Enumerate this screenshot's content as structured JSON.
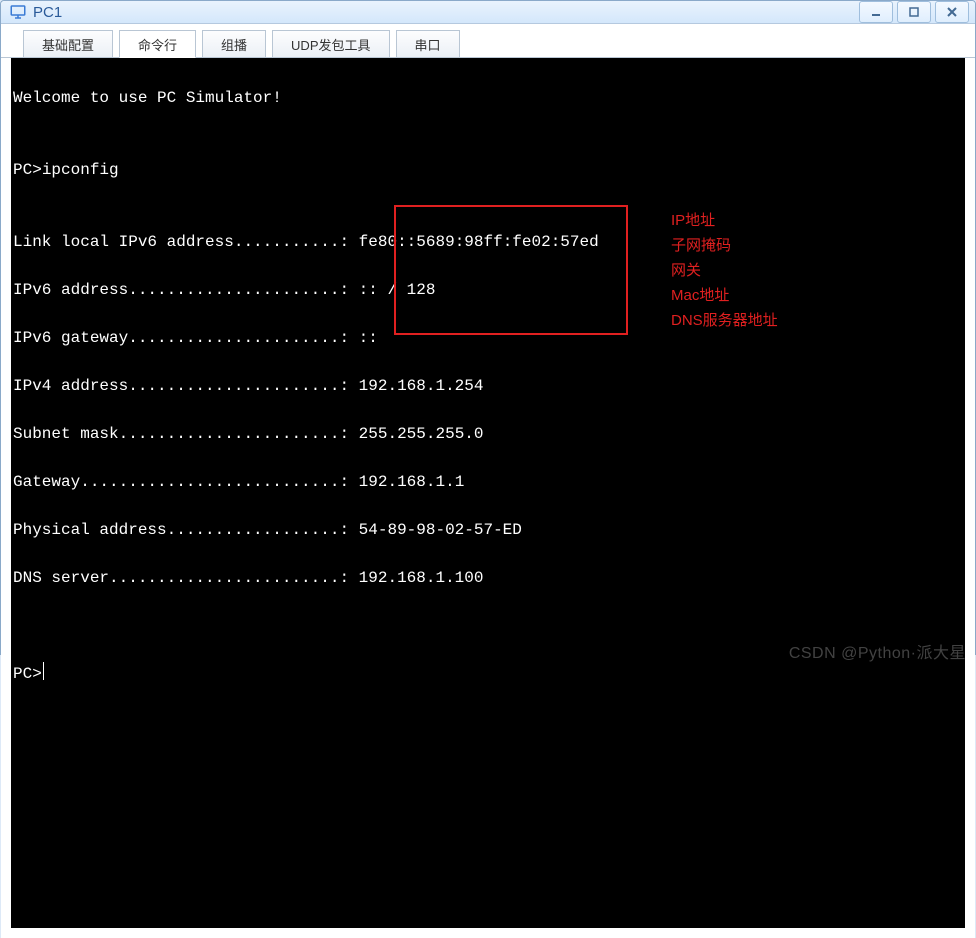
{
  "window": {
    "title": "PC1"
  },
  "tabs": [
    {
      "label": "基础配置"
    },
    {
      "label": "命令行"
    },
    {
      "label": "组播"
    },
    {
      "label": "UDP发包工具"
    },
    {
      "label": "串口"
    }
  ],
  "active_tab_index": 1,
  "terminal": {
    "welcome": "Welcome to use PC Simulator!",
    "prompt1": "PC>",
    "cmd1": "ipconfig",
    "blank": "",
    "rows": [
      {
        "label": "Link local IPv6 address",
        "dots": "...........",
        "value": "fe80::5689:98ff:fe02:57ed"
      },
      {
        "label": "IPv6 address",
        "dots": "......................",
        "value": ":: / 128"
      },
      {
        "label": "IPv6 gateway",
        "dots": "......................",
        "value": "::"
      },
      {
        "label": "IPv4 address",
        "dots": "......................",
        "value": "192.168.1.254"
      },
      {
        "label": "Subnet mask",
        "dots": ".......................",
        "value": "255.255.255.0"
      },
      {
        "label": "Gateway",
        "dots": "...........................",
        "value": "192.168.1.1"
      },
      {
        "label": "Physical address",
        "dots": "..................",
        "value": "54-89-98-02-57-ED"
      },
      {
        "label": "DNS server",
        "dots": "........................",
        "value": "192.168.1.100"
      }
    ],
    "prompt2": "PC>"
  },
  "annotations": {
    "ipv4": "IP地址",
    "subnet": "子网掩码",
    "gw": "网关",
    "mac": "Mac地址",
    "dns": "DNS服务器地址"
  },
  "colors": {
    "annotation": "#e02020",
    "terminal_bg": "#000000",
    "terminal_fg": "#ffffff",
    "window_accent": "#3a7bd5"
  },
  "watermark": "CSDN @Python·派大星"
}
